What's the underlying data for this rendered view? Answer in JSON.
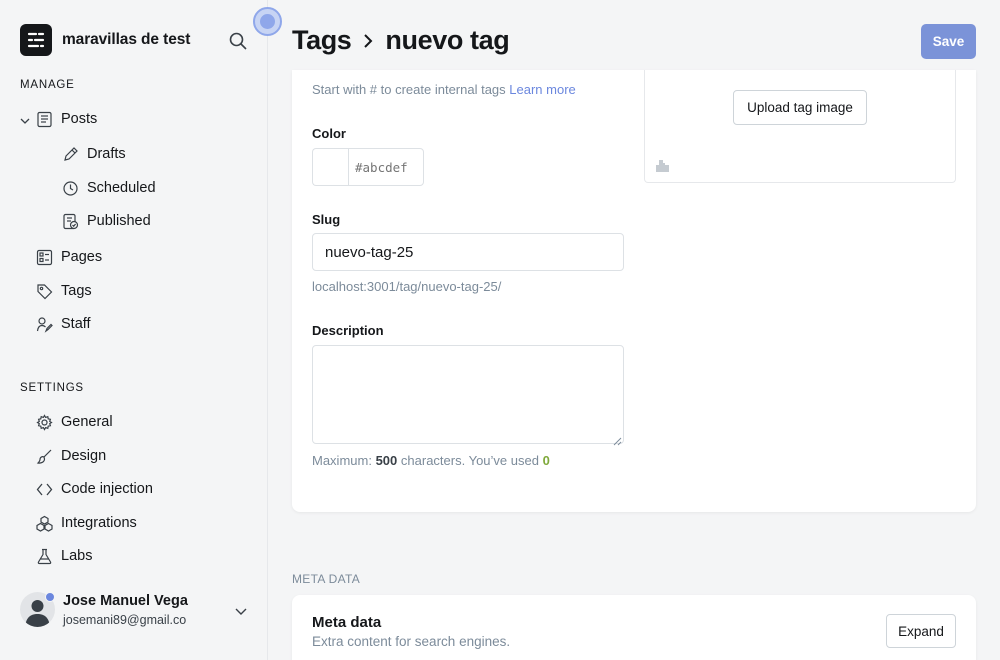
{
  "brand": {
    "name": "maravillas de test",
    "logo_icon": "ghost-logo-icon"
  },
  "sidebar": {
    "manage_label": "MANAGE",
    "items": [
      {
        "label": "Posts",
        "icon": "posts-icon"
      },
      {
        "label": "Drafts",
        "icon": "pencil-icon"
      },
      {
        "label": "Scheduled",
        "icon": "clock-icon"
      },
      {
        "label": "Published",
        "icon": "published-icon"
      },
      {
        "label": "Pages",
        "icon": "pages-icon"
      },
      {
        "label": "Tags",
        "icon": "tag-icon"
      },
      {
        "label": "Staff",
        "icon": "staff-icon"
      }
    ],
    "settings_label": "SETTINGS",
    "settings": [
      {
        "label": "General",
        "icon": "gear-icon"
      },
      {
        "label": "Design",
        "icon": "brush-icon"
      },
      {
        "label": "Code injection",
        "icon": "code-icon"
      },
      {
        "label": "Integrations",
        "icon": "integrations-icon"
      },
      {
        "label": "Labs",
        "icon": "flask-icon"
      }
    ]
  },
  "user": {
    "name": "Jose Manuel Vega",
    "email": "josemani89@gmail.co"
  },
  "header": {
    "crumb": "Tags",
    "title": "nuevo tag",
    "save_label": "Save"
  },
  "form": {
    "hint_text": "Start with # to create internal tags",
    "hint_link": "Learn more",
    "upload_label": "Upload tag image",
    "color_label": "Color",
    "color_placeholder": "#abcdef",
    "slug_label": "Slug",
    "slug_value": "nuevo-tag-25",
    "slug_url": "localhost:3001/tag/nuevo-tag-25/",
    "description_label": "Description",
    "counter_prefix": "Maximum:",
    "counter_max": "500",
    "counter_mid": "characters. You’ve used",
    "counter_used": "0"
  },
  "meta": {
    "section_label": "META DATA",
    "title": "Meta data",
    "subtitle": "Extra content for search engines.",
    "expand_label": "Expand"
  },
  "colors": {
    "accent": "#7b93d8",
    "link": "#6b87de",
    "used_count": "#7fa93a"
  }
}
